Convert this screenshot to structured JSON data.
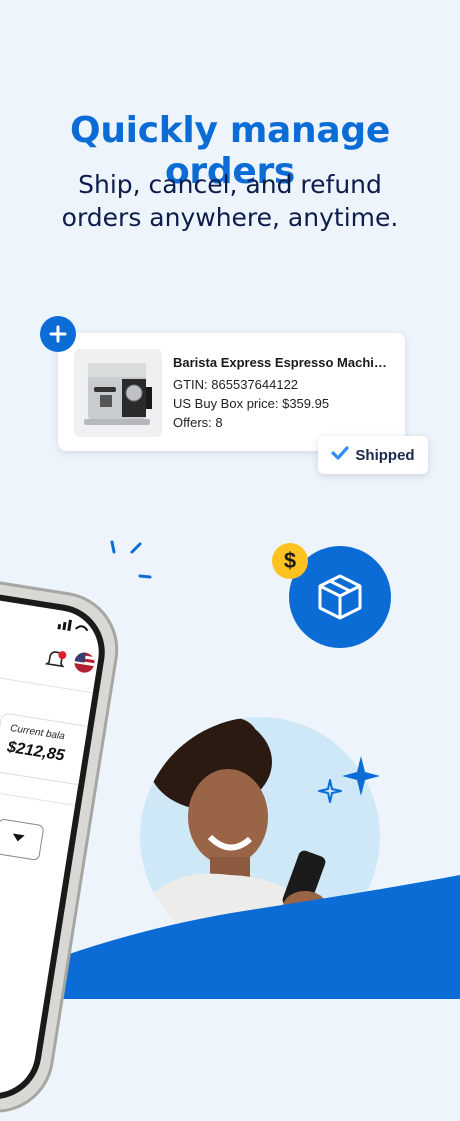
{
  "headline": "Quickly manage orders",
  "subline": [
    "Ship, cancel, and refund",
    "orders anywhere, anytime."
  ],
  "product_card": {
    "title": "Barista Express Espresso Machine...",
    "gtin": "GTIN: 865537644122",
    "price": "US Buy Box price: $359.95",
    "offers": "Offers: 8",
    "icon": "espresso-machine-image"
  },
  "status_badge": {
    "label": "Shipped",
    "icon": "check-icon"
  },
  "phone_screen": {
    "balance_label": "Current bala",
    "balance_value": "$212,85"
  },
  "icons": {
    "plus": "plus-icon",
    "box": "package-box-icon",
    "dollar": "$",
    "bell": "bell-icon",
    "flag": "us-flag-icon"
  },
  "colors": {
    "brand_blue": "#0c6cd6",
    "navy": "#0d1d4a",
    "yellow": "#ffc220",
    "background": "#eef4fb",
    "light_blue": "#cfe8f7"
  }
}
